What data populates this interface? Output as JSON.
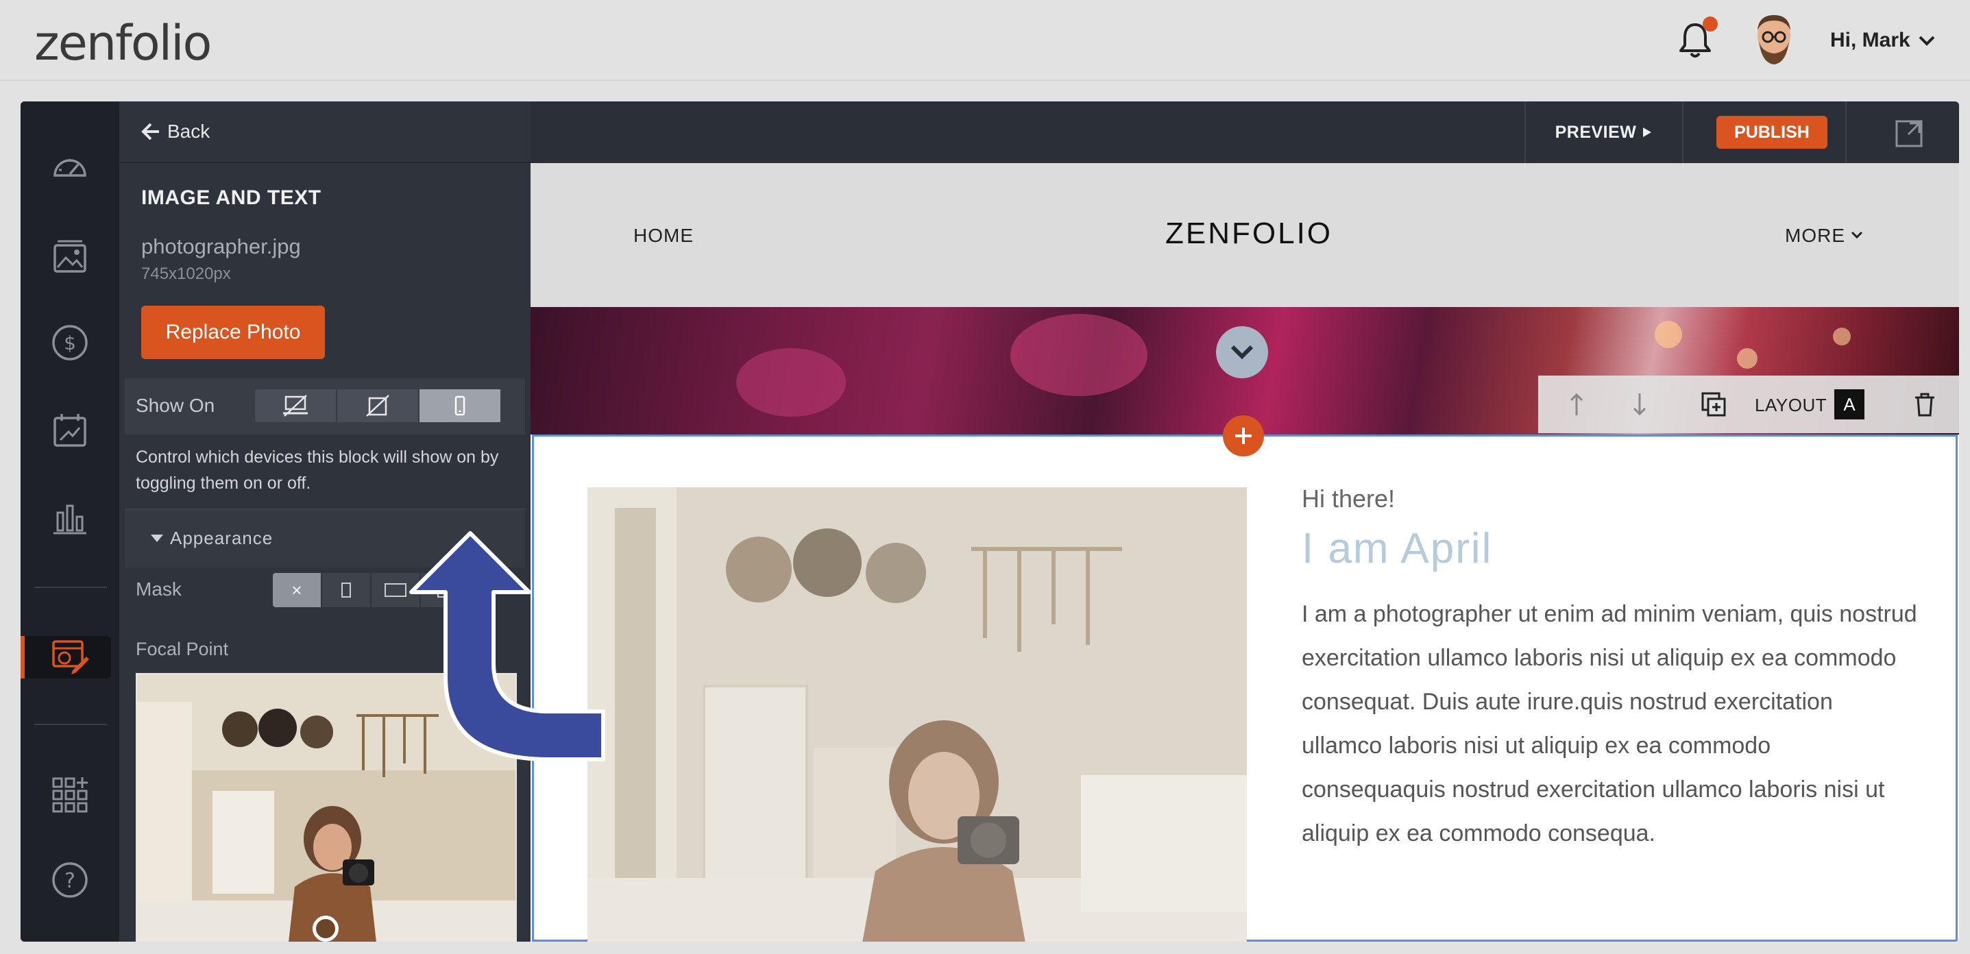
{
  "brand": {
    "logo_text": "zenfolio",
    "accent": "#d9541e"
  },
  "topbar": {
    "greeting": "Hi, Mark",
    "notification_dot_color": "#d9541e"
  },
  "rail": {
    "items": [
      {
        "icon": "dashboard-gauge-icon"
      },
      {
        "icon": "gallery-image-icon"
      },
      {
        "icon": "dollar-icon"
      },
      {
        "icon": "calendar-marketing-icon"
      },
      {
        "icon": "bar-chart-icon"
      },
      {
        "icon": "website-design-icon",
        "active": true
      },
      {
        "icon": "apps-grid-icon"
      },
      {
        "icon": "help-icon"
      }
    ]
  },
  "panel": {
    "back_label": "Back",
    "section_title": "IMAGE AND TEXT",
    "file_name": "photographer.jpg",
    "file_dims": "745x1020px",
    "replace_label": "Replace Photo",
    "show_on_label": "Show On",
    "show_on_options": [
      {
        "icon": "desktop-off-icon",
        "selected": false
      },
      {
        "icon": "tablet-off-icon",
        "selected": false
      },
      {
        "icon": "mobile-icon",
        "selected": true
      }
    ],
    "show_on_help": "Control which devices this block will show on by toggling them on or off.",
    "appearance_label": "Appearance",
    "mask_label": "Mask",
    "mask_options": [
      "none",
      "portrait",
      "landscape",
      "square"
    ],
    "mask_none_glyph": "×",
    "focal_label": "Focal Point"
  },
  "editor": {
    "preview_label": "PREVIEW",
    "publish_label": "PUBLISH"
  },
  "site": {
    "nav_home": "HOME",
    "nav_brand": "ZENFOLIO",
    "nav_more": "MORE",
    "layout_label": "LAYOUT",
    "layout_value": "A",
    "hi_there": "Hi there!",
    "headline": "I am April",
    "bio": "I am a photographer ut enim ad minim veniam, quis nostrud exercitation ullamco laboris nisi ut aliquip ex ea commodo consequat. Duis aute irure.quis nostrud exercitation ullamco laboris nisi ut aliquip ex ea commodo consequaquis nostrud exercitation ullamco laboris nisi ut aliquip ex ea commodo consequa.",
    "headline_color": "#b5cadb",
    "block_border_color": "#5d8fd8"
  }
}
